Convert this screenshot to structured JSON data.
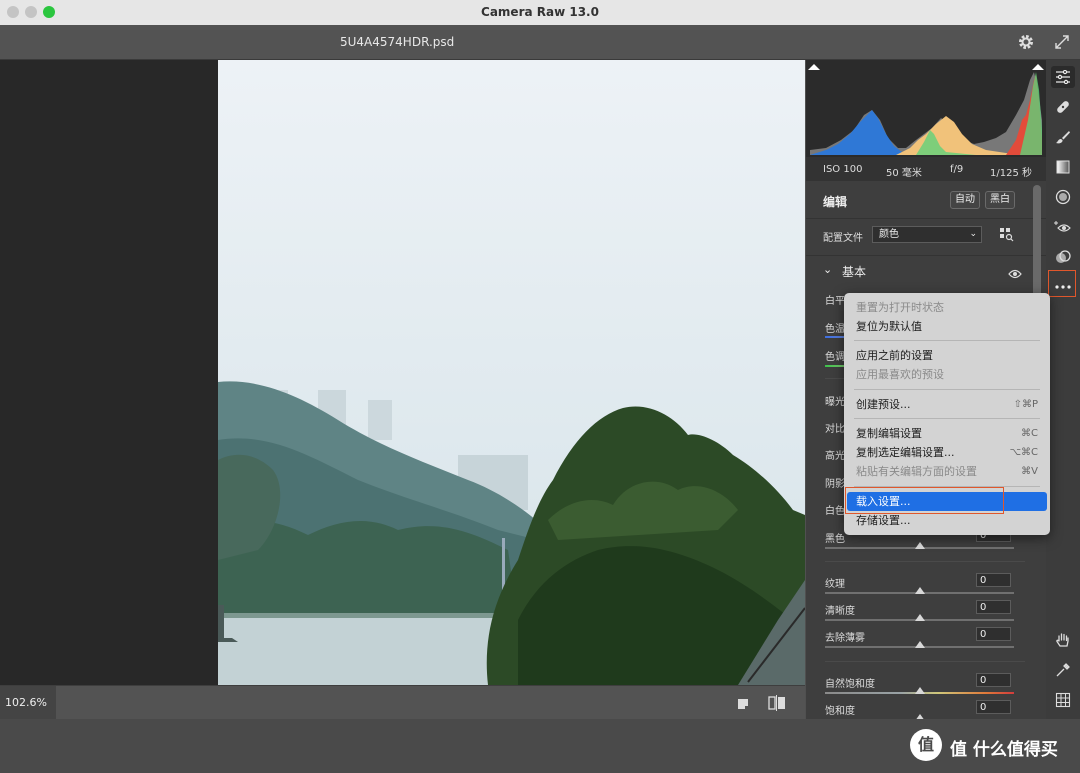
{
  "window": {
    "title": "Camera Raw 13.0"
  },
  "document": {
    "filename": "5U4A4574HDR.psd"
  },
  "zoom": {
    "level": "102.6%"
  },
  "exif": {
    "iso": "ISO 100",
    "focal": "50 毫米",
    "aperture": "f/9",
    "shutter": "1/125 秒"
  },
  "edit": {
    "title": "编辑",
    "auto_label": "自动",
    "bw_label": "黑白"
  },
  "profile": {
    "label": "配置文件",
    "value": "颜色"
  },
  "basic": {
    "title": "基本"
  },
  "truncated_labels": [
    "白平",
    "色温",
    "色调",
    "曝光",
    "对比",
    "高光",
    "阴影",
    "白色"
  ],
  "sliders": [
    {
      "label": "黑色",
      "value": "0",
      "thumb": 0.5
    },
    {
      "label": "纹理",
      "value": "0",
      "thumb": 0.5
    },
    {
      "label": "清晰度",
      "value": "0",
      "thumb": 0.5
    },
    {
      "label": "去除薄雾",
      "value": "0",
      "thumb": 0.5
    },
    {
      "label": "自然饱和度",
      "value": "0",
      "thumb": 0.5
    },
    {
      "label": "饱和度",
      "value": "0",
      "thumb": 0.5
    }
  ],
  "menu": {
    "items": [
      {
        "label": "重置为打开时状态",
        "shortcut": "",
        "disabled": true
      },
      {
        "label": "复位为默认值",
        "shortcut": "",
        "disabled": false
      },
      {
        "label": "应用之前的设置",
        "shortcut": "",
        "disabled": false
      },
      {
        "label": "应用最喜欢的预设",
        "shortcut": "",
        "disabled": true
      },
      {
        "label": "创建预设...",
        "shortcut": "⇧⌘P",
        "disabled": false
      },
      {
        "label": "复制编辑设置",
        "shortcut": "⌘C",
        "disabled": false
      },
      {
        "label": "复制选定编辑设置...",
        "shortcut": "⌥⌘C",
        "disabled": false
      },
      {
        "label": "粘贴有关编辑方面的设置",
        "shortcut": "⌘V",
        "disabled": true
      },
      {
        "label": "载入设置...",
        "shortcut": "",
        "disabled": false,
        "selected": true
      },
      {
        "label": "存储设置...",
        "shortcut": "",
        "disabled": false
      }
    ]
  },
  "tools": [
    "edit-sliders-icon",
    "healing-icon",
    "brush-icon",
    "linear-gradient-icon",
    "radial-gradient-icon",
    "red-eye-icon",
    "presets-icon",
    "more-icon"
  ],
  "bottom_tools": [
    "hand-icon",
    "white-balance-eyedropper-icon",
    "grid-icon"
  ],
  "watermark": {
    "text": "值 什么值得买"
  },
  "colors": {
    "menu_highlight": "#1f6fe4",
    "callout": "#e0572c",
    "panel_bg": "#3e3e3e"
  }
}
